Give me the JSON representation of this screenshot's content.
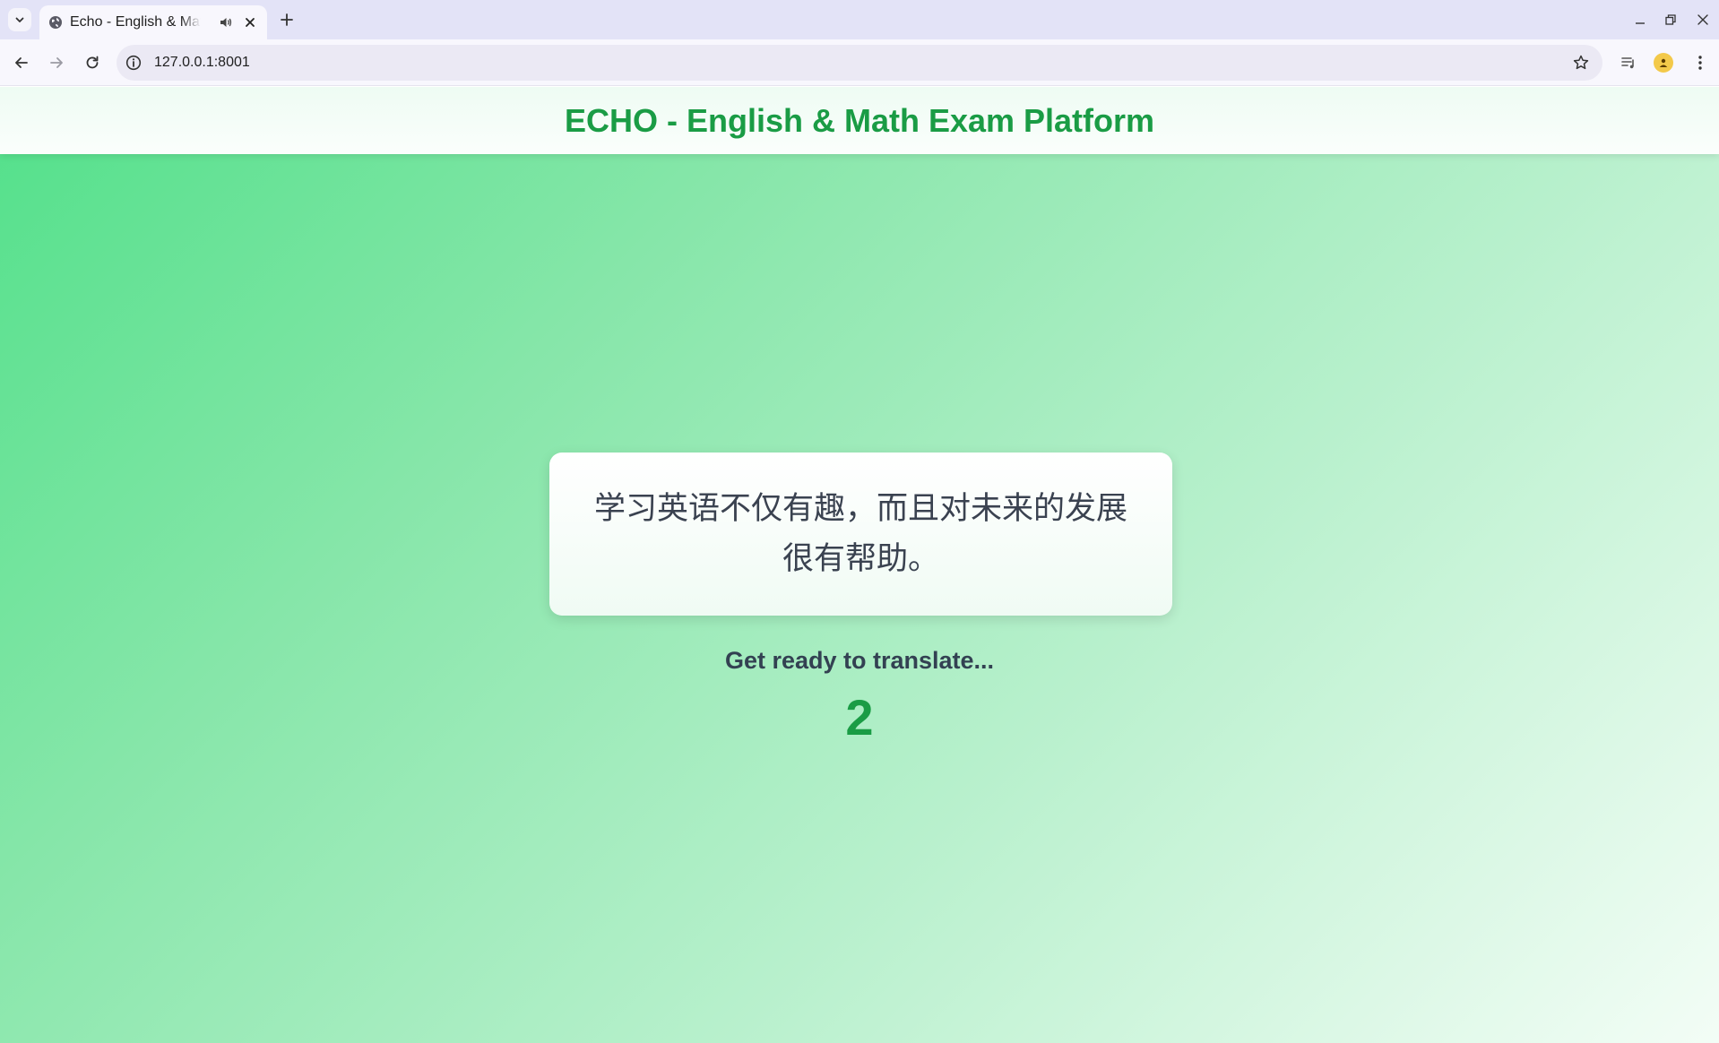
{
  "browser": {
    "tab_title": "Echo - English & Math Exam Platform",
    "url": "127.0.0.1:8001",
    "icons": {
      "tab_list": "chevron-down-icon",
      "favicon": "globe-icon",
      "audio": "speaker-icon",
      "close_tab": "close-icon",
      "new_tab": "plus-icon",
      "minimize": "minimize-icon",
      "restore": "restore-icon",
      "close_window": "close-icon",
      "back": "arrow-left-icon",
      "forward": "arrow-right-icon",
      "reload": "reload-icon",
      "site_info": "info-icon",
      "bookmark": "star-icon",
      "media": "media-control-icon",
      "profile": "avatar",
      "menu": "kebab-menu-icon"
    }
  },
  "app": {
    "title": "ECHO - English & Math Exam Platform",
    "prompt_sentence": "学习英语不仅有趣，而且对未来的发展很有帮助。",
    "status": "Get ready to translate...",
    "countdown": "2"
  },
  "colors": {
    "brand": "#1a9c45",
    "gradient_start": "#52e08a",
    "gradient_end": "#f3fdf6",
    "text_dark": "#334152"
  }
}
